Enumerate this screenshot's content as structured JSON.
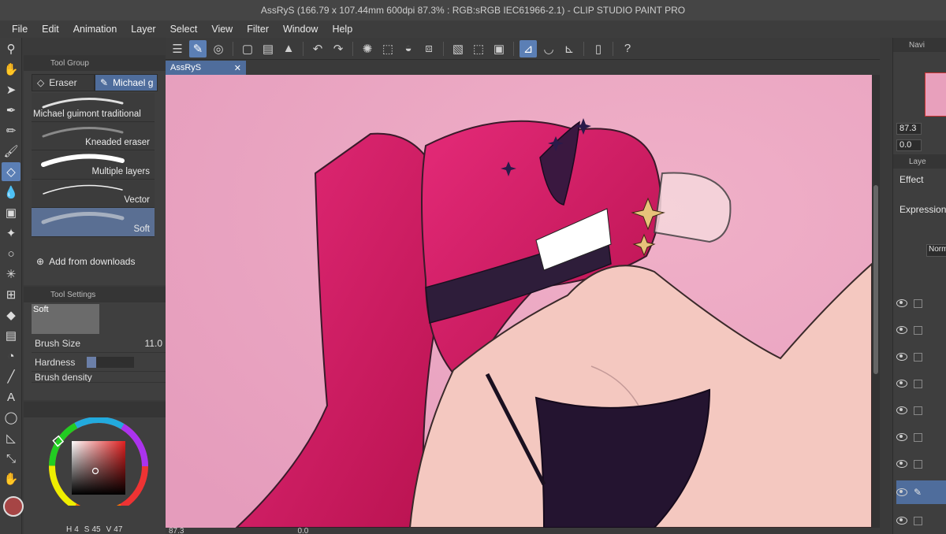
{
  "window": {
    "title": "AssRyS (166.79 x 107.44mm 600dpi 87.3% : RGB:sRGB IEC61966-2.1)  - CLIP STUDIO PAINT PRO"
  },
  "menu": [
    "File",
    "Edit",
    "Animation",
    "Layer",
    "Select",
    "View",
    "Filter",
    "Window",
    "Help"
  ],
  "tool_group": {
    "header": "Tool Group",
    "tabs": [
      "Eraser",
      "Michael g"
    ],
    "brushes": [
      {
        "name": "Michael guimont traditional"
      },
      {
        "name": "Kneaded eraser"
      },
      {
        "name": "Multiple layers"
      },
      {
        "name": "Vector"
      },
      {
        "name": "Soft"
      }
    ],
    "add_downloads": "Add from downloads"
  },
  "tool_settings": {
    "header": "Tool Settings",
    "preset_name": "Soft",
    "brush_size_label": "Brush Size",
    "brush_size_value": "11.0",
    "hardness_label": "Hardness",
    "brush_density_label": "Brush density",
    "hardness_level": 0.2
  },
  "color": {
    "main": "#a64545",
    "sub": "#d07070",
    "hue_label": "H",
    "hue": "4",
    "sat_label": "S",
    "sat": "45",
    "val_label": "V",
    "val": "47"
  },
  "document": {
    "tab_name": "AssRyS",
    "zoom": "87.3",
    "rotation": "0.0"
  },
  "right": {
    "navigator_label": "Navi",
    "zoom": "87.3",
    "rotation": "0.0",
    "layer_property_label": "Laye",
    "effect_label": "Effect",
    "expression_label": "Expression",
    "blend_mode": "Norm"
  }
}
